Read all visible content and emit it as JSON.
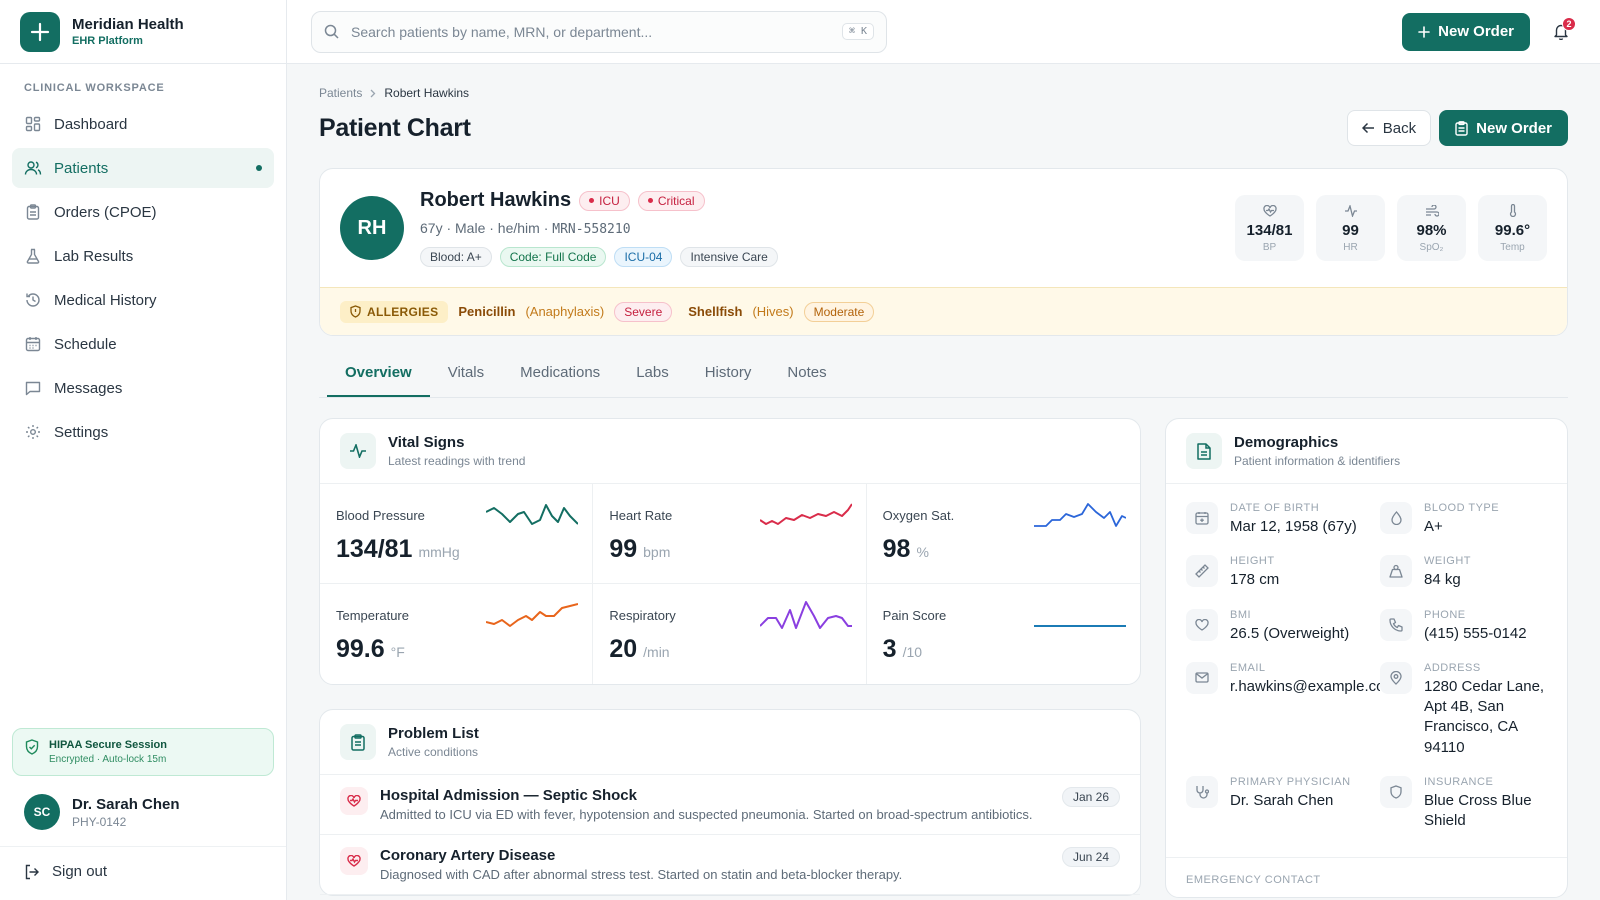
{
  "brand": {
    "name": "Meridian Health",
    "subtitle": "EHR Platform"
  },
  "sidebar": {
    "section": "CLINICAL WORKSPACE",
    "items": [
      {
        "label": "Dashboard",
        "icon": "dashboard-icon"
      },
      {
        "label": "Patients",
        "icon": "users-icon",
        "active": true
      },
      {
        "label": "Orders (CPOE)",
        "icon": "clipboard-icon"
      },
      {
        "label": "Lab Results",
        "icon": "flask-icon"
      },
      {
        "label": "Medical History",
        "icon": "history-icon"
      },
      {
        "label": "Schedule",
        "icon": "calendar-icon"
      },
      {
        "label": "Messages",
        "icon": "message-icon"
      },
      {
        "label": "Settings",
        "icon": "gear-icon"
      }
    ],
    "hipaa": {
      "title": "HIPAA Secure Session",
      "subtitle": "Encrypted · Auto-lock 15m"
    },
    "user": {
      "initials": "SC",
      "name": "Dr. Sarah Chen",
      "id": "PHY-0142"
    },
    "signout": "Sign out"
  },
  "topbar": {
    "search_placeholder": "Search patients by name, MRN, or department...",
    "shortcut": "⌘ K",
    "new_order": "New Order",
    "notifications": "2"
  },
  "breadcrumb": {
    "parent": "Patients",
    "current": "Robert Hawkins"
  },
  "page": {
    "title": "Patient Chart",
    "back": "Back",
    "new_order": "New Order"
  },
  "patient": {
    "initials": "RH",
    "name": "Robert Hawkins",
    "badges": [
      "ICU",
      "Critical"
    ],
    "meta": "67y · Male · he/him · ",
    "mrn": "MRN-558210",
    "tags": [
      "Blood: A+",
      "Code: Full Code",
      "ICU-04",
      "Intensive Care"
    ],
    "mini_vitals": [
      {
        "value": "134/81",
        "label": "BP",
        "icon": "heart-pulse-icon"
      },
      {
        "value": "99",
        "label": "HR",
        "icon": "activity-icon"
      },
      {
        "value": "98%",
        "label": "SpO₂",
        "icon": "wind-icon"
      },
      {
        "value": "99.6°",
        "label": "Temp",
        "icon": "thermometer-icon"
      }
    ]
  },
  "allergies": {
    "label": "ALLERGIES",
    "items": [
      {
        "name": "Penicillin",
        "reaction": "(Anaphylaxis)",
        "severity": "Severe"
      },
      {
        "name": "Shellfish",
        "reaction": "(Hives)",
        "severity": "Moderate"
      }
    ]
  },
  "tabs": [
    "Overview",
    "Vitals",
    "Medications",
    "Labs",
    "History",
    "Notes"
  ],
  "vitals_card": {
    "title": "Vital Signs",
    "subtitle": "Latest readings with trend",
    "items": [
      {
        "label": "Blood Pressure",
        "value": "134/81",
        "unit": "mmHg",
        "color": "#136e62"
      },
      {
        "label": "Heart Rate",
        "value": "99",
        "unit": "bpm",
        "color": "#d92c4a"
      },
      {
        "label": "Oxygen Sat.",
        "value": "98",
        "unit": "%",
        "color": "#2b66d9"
      },
      {
        "label": "Temperature",
        "value": "99.6",
        "unit": "°F",
        "color": "#e8651c"
      },
      {
        "label": "Respiratory",
        "value": "20",
        "unit": "/min",
        "color": "#8a3fe0"
      },
      {
        "label": "Pain Score",
        "value": "3",
        "unit": "/10",
        "color": "#1b7bb5"
      }
    ]
  },
  "problems": {
    "title": "Problem List",
    "subtitle": "Active conditions",
    "items": [
      {
        "title": "Hospital Admission — Septic Shock",
        "desc": "Admitted to ICU via ED with fever, hypotension and suspected pneumonia. Started on broad-spectrum antibiotics.",
        "date": "Jan 26"
      },
      {
        "title": "Coronary Artery Disease",
        "desc": "Diagnosed with CAD after abnormal stress test. Started on statin and beta-blocker therapy.",
        "date": "Jun 24"
      }
    ]
  },
  "demographics": {
    "title": "Demographics",
    "subtitle": "Patient information & identifiers",
    "items": [
      {
        "label": "DATE OF BIRTH",
        "value": "Mar 12, 1958 (67y)",
        "icon": "calendar-plus-icon"
      },
      {
        "label": "BLOOD TYPE",
        "value": "A+",
        "icon": "droplet-icon"
      },
      {
        "label": "HEIGHT",
        "value": "178 cm",
        "icon": "ruler-icon"
      },
      {
        "label": "WEIGHT",
        "value": "84 kg",
        "icon": "weight-icon"
      },
      {
        "label": "BMI",
        "value": "26.5 (Overweight)",
        "icon": "heart-icon"
      },
      {
        "label": "PHONE",
        "value": "(415) 555-0142",
        "icon": "phone-icon"
      },
      {
        "label": "EMAIL",
        "value": "r.hawkins@example.com",
        "icon": "mail-icon"
      },
      {
        "label": "ADDRESS",
        "value": "1280 Cedar Lane, Apt 4B, San Francisco, CA 94110",
        "icon": "map-pin-icon"
      },
      {
        "label": "PRIMARY PHYSICIAN",
        "value": "Dr. Sarah Chen",
        "icon": "stethoscope-icon"
      },
      {
        "label": "INSURANCE",
        "value": "Blue Cross Blue Shield",
        "icon": "shield-icon"
      }
    ],
    "emergency_label": "EMERGENCY CONTACT"
  }
}
